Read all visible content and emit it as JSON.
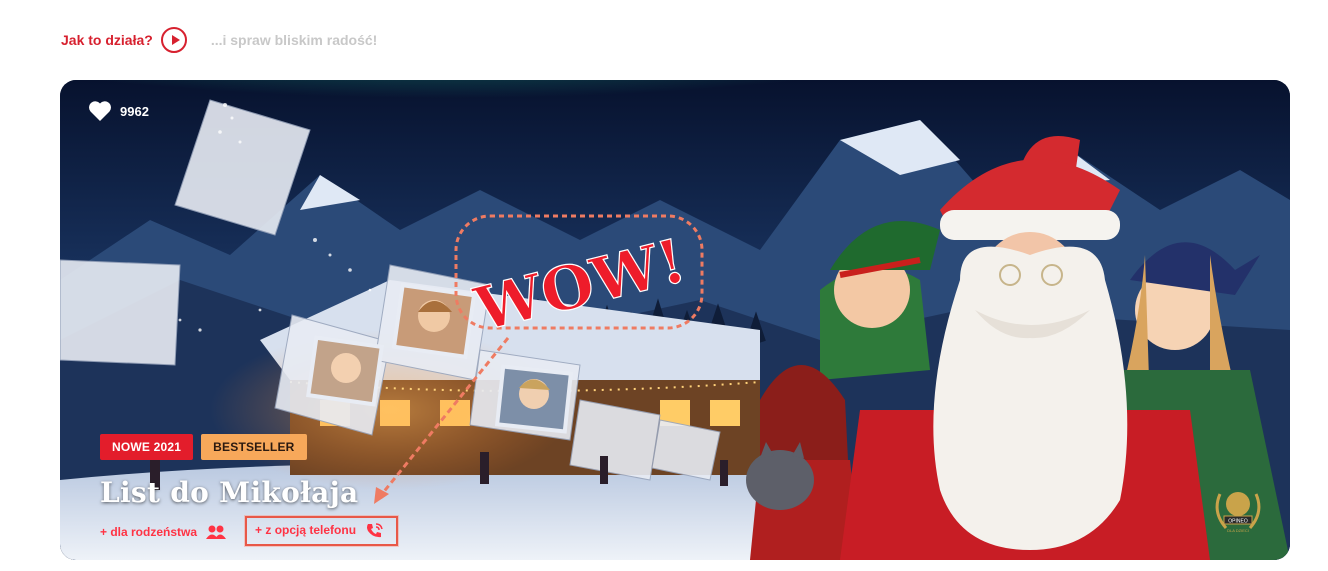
{
  "subnav": {
    "how_label": "Jak to działa?",
    "tagline": "...i spraw bliskim radość!"
  },
  "hero": {
    "likes": "9962",
    "badges": [
      "NOWE 2021",
      "BESTSELLER"
    ],
    "title": "List do Mikołaja",
    "options": [
      {
        "label": "+ dla rodzeństwa",
        "icon": "users-icon"
      },
      {
        "label": "+ z opcją telefonu",
        "icon": "phone-icon"
      }
    ],
    "annotation_text": "WOW!",
    "award_text": "OPINEO",
    "award_sub": "DLA DZIECI"
  },
  "colors": {
    "brand_red": "#d7212f",
    "badge_new": "#e31d2b",
    "badge_best": "#f7a85a",
    "muted": "#c8c8c8",
    "sky": "#0d1a3a",
    "aurora": "#2fd3a0"
  }
}
